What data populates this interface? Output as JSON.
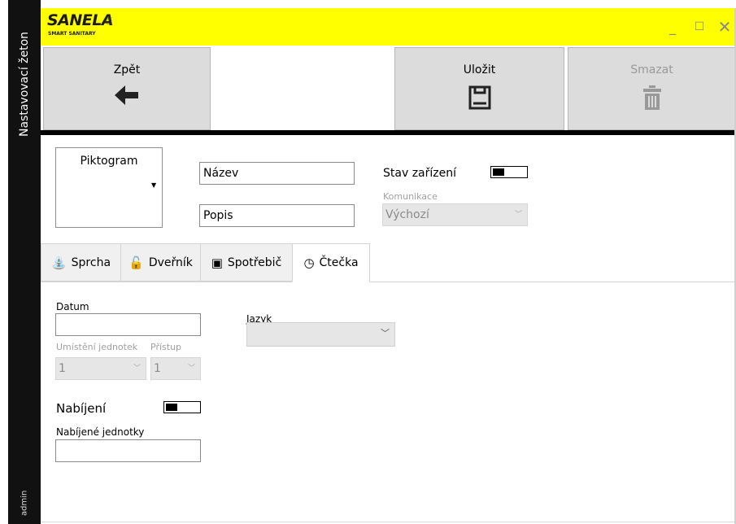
{
  "sidebar": {
    "title": "Nastavovací žeton",
    "user": "admin"
  },
  "titlebar": {
    "logo_text": "SANELA",
    "logo_sub": "SMART SANITARY",
    "minimize_icon": "_",
    "maximize_icon": "☐",
    "close_icon": "✕"
  },
  "toolbar": {
    "back_label": "Zpět",
    "save_label": "Uložit",
    "delete_label": "Smazat"
  },
  "form": {
    "pictogram_label": "Piktogram",
    "name_value": "Název",
    "description_value": "Popis",
    "device_state_label": "Stav zařízení",
    "device_state_on": false,
    "communication_label": "Komunikace",
    "communication_value": "Výchozí"
  },
  "tabs": [
    {
      "label": "Sprcha",
      "icon": "shower-icon"
    },
    {
      "label": "Dveřník",
      "icon": "unlock-icon"
    },
    {
      "label": "Spotřebič",
      "icon": "appliance-icon"
    },
    {
      "label": "Čtečka",
      "icon": "reader-icon",
      "selected": true
    }
  ],
  "reader": {
    "date_label": "Datum",
    "date_value": "",
    "language_label": "Jazyk",
    "language_value": "",
    "unit_location_label": "Umístění jednotek",
    "unit_location_value": "1",
    "access_label": "Přístup",
    "access_value": "1",
    "charging_label": "Nabíjení",
    "charging_on": false,
    "charged_units_label": "Nabíjené jednotky",
    "charged_units_value": ""
  },
  "colors": {
    "titlebar_bg": "#ffff00",
    "sidebar_bg": "#111111",
    "button_bg": "#dcdcdc",
    "disabled_text": "#a0a0a0"
  }
}
